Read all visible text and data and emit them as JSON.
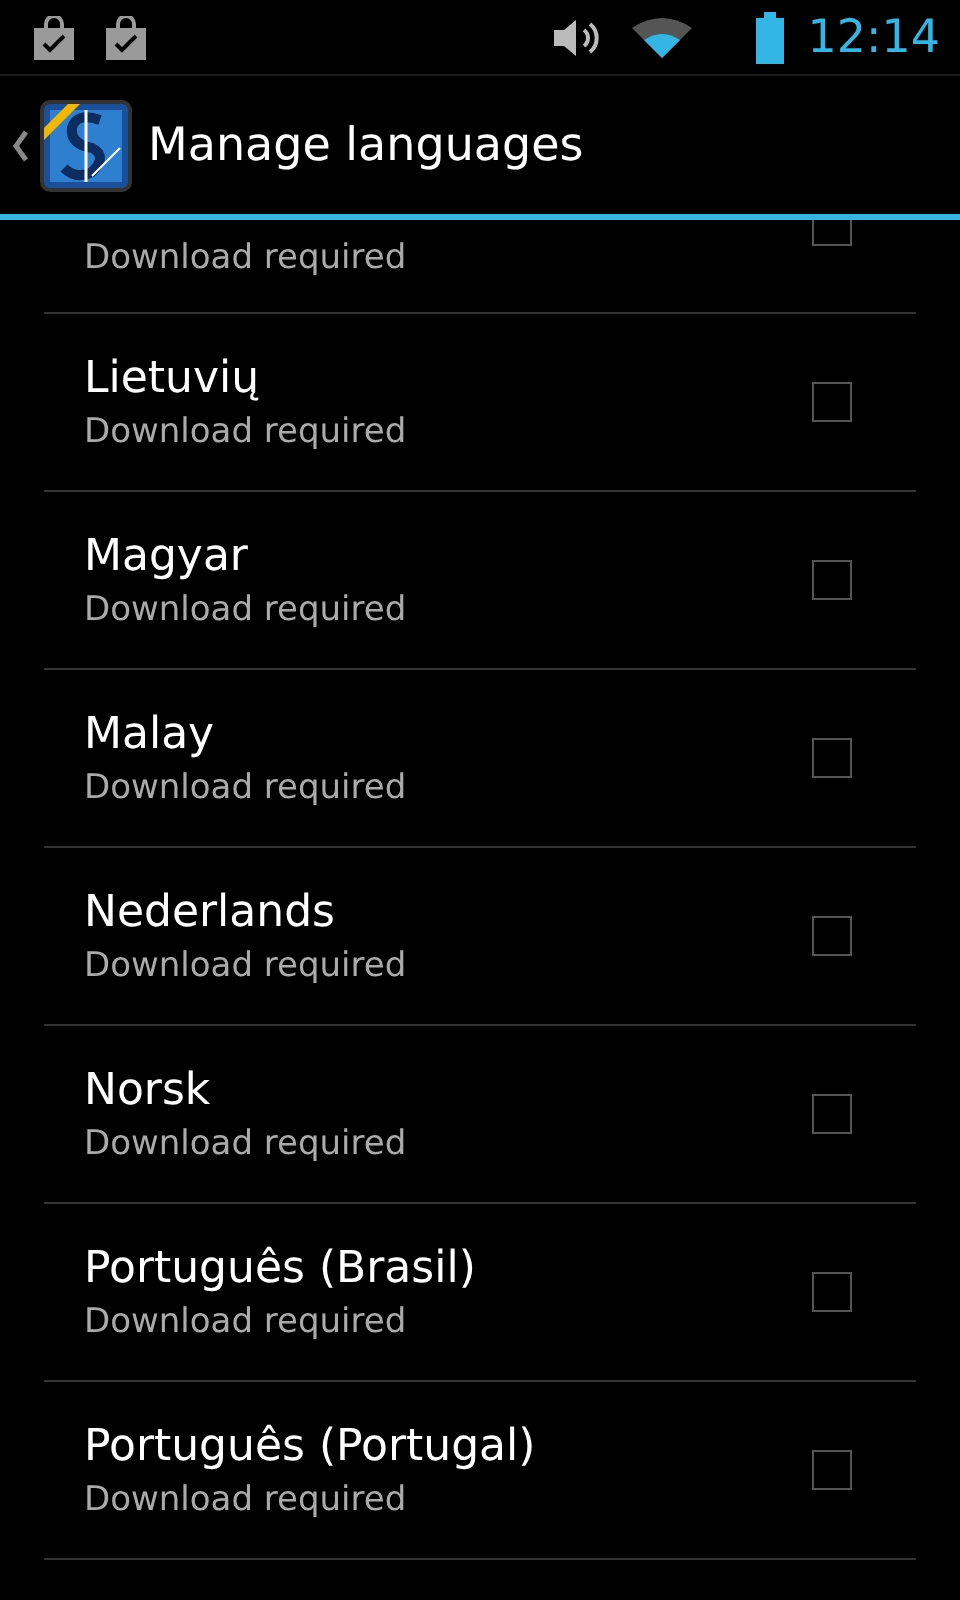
{
  "status_bar": {
    "time": "12:14"
  },
  "action_bar": {
    "title": "Manage languages"
  },
  "languages": [
    {
      "status": "Download required",
      "checked": false
    },
    {
      "name": "Lietuvių",
      "status": "Download required",
      "checked": false
    },
    {
      "name": "Magyar",
      "status": "Download required",
      "checked": false
    },
    {
      "name": "Malay",
      "status": "Download required",
      "checked": false
    },
    {
      "name": "Nederlands",
      "status": "Download required",
      "checked": false
    },
    {
      "name": "Norsk",
      "status": "Download required",
      "checked": false
    },
    {
      "name": "Português (Brasil)",
      "status": "Download required",
      "checked": false
    },
    {
      "name": "Português (Portugal)",
      "status": "Download required",
      "checked": false
    }
  ]
}
